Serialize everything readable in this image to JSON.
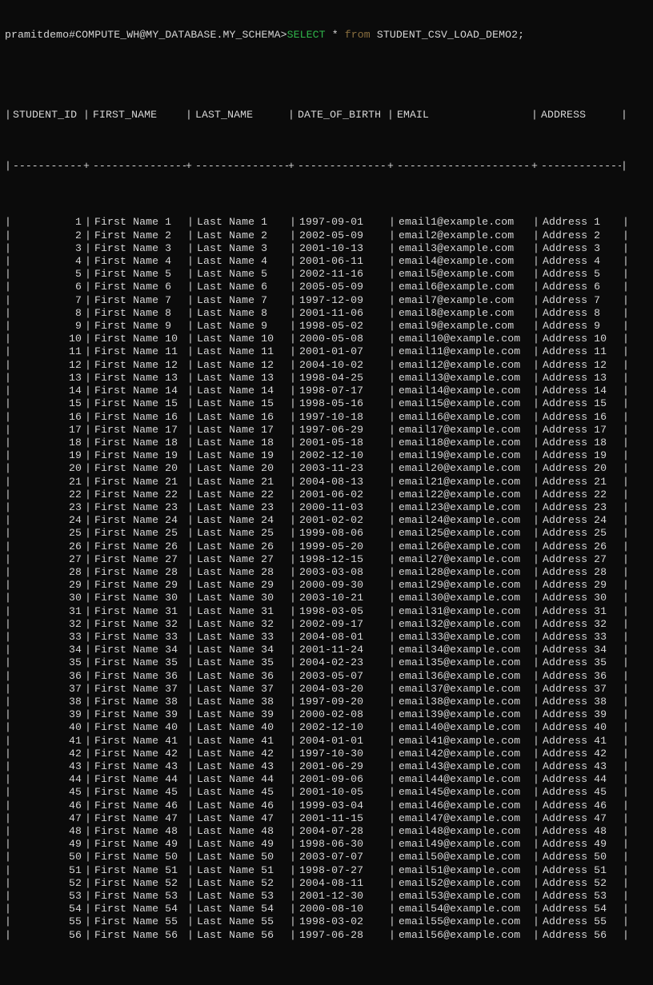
{
  "prompt": {
    "prefix": "pramitdemo#COMPUTE_WH@MY_DATABASE.MY_SCHEMA>",
    "select": "SELECT",
    "star": " * ",
    "from": "from",
    "rest": " STUDENT_CSV_LOAD_DEMO2;"
  },
  "columns": [
    "STUDENT_ID",
    "FIRST_NAME",
    "LAST_NAME",
    "DATE_OF_BIRTH",
    "EMAIL",
    "ADDRESS"
  ],
  "rows": [
    {
      "id": 1,
      "fn": "First Name 1",
      "ln": "Last Name 1",
      "dob": "1997-09-01",
      "em": "email1@example.com",
      "ad": "Address 1"
    },
    {
      "id": 2,
      "fn": "First Name 2",
      "ln": "Last Name 2",
      "dob": "2002-05-09",
      "em": "email2@example.com",
      "ad": "Address 2"
    },
    {
      "id": 3,
      "fn": "First Name 3",
      "ln": "Last Name 3",
      "dob": "2001-10-13",
      "em": "email3@example.com",
      "ad": "Address 3"
    },
    {
      "id": 4,
      "fn": "First Name 4",
      "ln": "Last Name 4",
      "dob": "2001-06-11",
      "em": "email4@example.com",
      "ad": "Address 4"
    },
    {
      "id": 5,
      "fn": "First Name 5",
      "ln": "Last Name 5",
      "dob": "2002-11-16",
      "em": "email5@example.com",
      "ad": "Address 5"
    },
    {
      "id": 6,
      "fn": "First Name 6",
      "ln": "Last Name 6",
      "dob": "2005-05-09",
      "em": "email6@example.com",
      "ad": "Address 6"
    },
    {
      "id": 7,
      "fn": "First Name 7",
      "ln": "Last Name 7",
      "dob": "1997-12-09",
      "em": "email7@example.com",
      "ad": "Address 7"
    },
    {
      "id": 8,
      "fn": "First Name 8",
      "ln": "Last Name 8",
      "dob": "2001-11-06",
      "em": "email8@example.com",
      "ad": "Address 8"
    },
    {
      "id": 9,
      "fn": "First Name 9",
      "ln": "Last Name 9",
      "dob": "1998-05-02",
      "em": "email9@example.com",
      "ad": "Address 9"
    },
    {
      "id": 10,
      "fn": "First Name 10",
      "ln": "Last Name 10",
      "dob": "2000-05-08",
      "em": "email10@example.com",
      "ad": "Address 10"
    },
    {
      "id": 11,
      "fn": "First Name 11",
      "ln": "Last Name 11",
      "dob": "2001-01-07",
      "em": "email11@example.com",
      "ad": "Address 11"
    },
    {
      "id": 12,
      "fn": "First Name 12",
      "ln": "Last Name 12",
      "dob": "2004-10-02",
      "em": "email12@example.com",
      "ad": "Address 12"
    },
    {
      "id": 13,
      "fn": "First Name 13",
      "ln": "Last Name 13",
      "dob": "1998-04-25",
      "em": "email13@example.com",
      "ad": "Address 13"
    },
    {
      "id": 14,
      "fn": "First Name 14",
      "ln": "Last Name 14",
      "dob": "1998-07-17",
      "em": "email14@example.com",
      "ad": "Address 14"
    },
    {
      "id": 15,
      "fn": "First Name 15",
      "ln": "Last Name 15",
      "dob": "1998-05-16",
      "em": "email15@example.com",
      "ad": "Address 15"
    },
    {
      "id": 16,
      "fn": "First Name 16",
      "ln": "Last Name 16",
      "dob": "1997-10-18",
      "em": "email16@example.com",
      "ad": "Address 16"
    },
    {
      "id": 17,
      "fn": "First Name 17",
      "ln": "Last Name 17",
      "dob": "1997-06-29",
      "em": "email17@example.com",
      "ad": "Address 17"
    },
    {
      "id": 18,
      "fn": "First Name 18",
      "ln": "Last Name 18",
      "dob": "2001-05-18",
      "em": "email18@example.com",
      "ad": "Address 18"
    },
    {
      "id": 19,
      "fn": "First Name 19",
      "ln": "Last Name 19",
      "dob": "2002-12-10",
      "em": "email19@example.com",
      "ad": "Address 19"
    },
    {
      "id": 20,
      "fn": "First Name 20",
      "ln": "Last Name 20",
      "dob": "2003-11-23",
      "em": "email20@example.com",
      "ad": "Address 20"
    },
    {
      "id": 21,
      "fn": "First Name 21",
      "ln": "Last Name 21",
      "dob": "2004-08-13",
      "em": "email21@example.com",
      "ad": "Address 21"
    },
    {
      "id": 22,
      "fn": "First Name 22",
      "ln": "Last Name 22",
      "dob": "2001-06-02",
      "em": "email22@example.com",
      "ad": "Address 22"
    },
    {
      "id": 23,
      "fn": "First Name 23",
      "ln": "Last Name 23",
      "dob": "2000-11-03",
      "em": "email23@example.com",
      "ad": "Address 23"
    },
    {
      "id": 24,
      "fn": "First Name 24",
      "ln": "Last Name 24",
      "dob": "2001-02-02",
      "em": "email24@example.com",
      "ad": "Address 24"
    },
    {
      "id": 25,
      "fn": "First Name 25",
      "ln": "Last Name 25",
      "dob": "1999-08-06",
      "em": "email25@example.com",
      "ad": "Address 25"
    },
    {
      "id": 26,
      "fn": "First Name 26",
      "ln": "Last Name 26",
      "dob": "1999-05-20",
      "em": "email26@example.com",
      "ad": "Address 26"
    },
    {
      "id": 27,
      "fn": "First Name 27",
      "ln": "Last Name 27",
      "dob": "1998-12-15",
      "em": "email27@example.com",
      "ad": "Address 27"
    },
    {
      "id": 28,
      "fn": "First Name 28",
      "ln": "Last Name 28",
      "dob": "2003-03-08",
      "em": "email28@example.com",
      "ad": "Address 28"
    },
    {
      "id": 29,
      "fn": "First Name 29",
      "ln": "Last Name 29",
      "dob": "2000-09-30",
      "em": "email29@example.com",
      "ad": "Address 29"
    },
    {
      "id": 30,
      "fn": "First Name 30",
      "ln": "Last Name 30",
      "dob": "2003-10-21",
      "em": "email30@example.com",
      "ad": "Address 30"
    },
    {
      "id": 31,
      "fn": "First Name 31",
      "ln": "Last Name 31",
      "dob": "1998-03-05",
      "em": "email31@example.com",
      "ad": "Address 31"
    },
    {
      "id": 32,
      "fn": "First Name 32",
      "ln": "Last Name 32",
      "dob": "2002-09-17",
      "em": "email32@example.com",
      "ad": "Address 32"
    },
    {
      "id": 33,
      "fn": "First Name 33",
      "ln": "Last Name 33",
      "dob": "2004-08-01",
      "em": "email33@example.com",
      "ad": "Address 33"
    },
    {
      "id": 34,
      "fn": "First Name 34",
      "ln": "Last Name 34",
      "dob": "2001-11-24",
      "em": "email34@example.com",
      "ad": "Address 34"
    },
    {
      "id": 35,
      "fn": "First Name 35",
      "ln": "Last Name 35",
      "dob": "2004-02-23",
      "em": "email35@example.com",
      "ad": "Address 35"
    },
    {
      "id": 36,
      "fn": "First Name 36",
      "ln": "Last Name 36",
      "dob": "2003-05-07",
      "em": "email36@example.com",
      "ad": "Address 36"
    },
    {
      "id": 37,
      "fn": "First Name 37",
      "ln": "Last Name 37",
      "dob": "2004-03-20",
      "em": "email37@example.com",
      "ad": "Address 37"
    },
    {
      "id": 38,
      "fn": "First Name 38",
      "ln": "Last Name 38",
      "dob": "1997-09-20",
      "em": "email38@example.com",
      "ad": "Address 38"
    },
    {
      "id": 39,
      "fn": "First Name 39",
      "ln": "Last Name 39",
      "dob": "2000-02-08",
      "em": "email39@example.com",
      "ad": "Address 39"
    },
    {
      "id": 40,
      "fn": "First Name 40",
      "ln": "Last Name 40",
      "dob": "2002-12-10",
      "em": "email40@example.com",
      "ad": "Address 40"
    },
    {
      "id": 41,
      "fn": "First Name 41",
      "ln": "Last Name 41",
      "dob": "2004-01-01",
      "em": "email41@example.com",
      "ad": "Address 41"
    },
    {
      "id": 42,
      "fn": "First Name 42",
      "ln": "Last Name 42",
      "dob": "1997-10-30",
      "em": "email42@example.com",
      "ad": "Address 42"
    },
    {
      "id": 43,
      "fn": "First Name 43",
      "ln": "Last Name 43",
      "dob": "2001-06-29",
      "em": "email43@example.com",
      "ad": "Address 43"
    },
    {
      "id": 44,
      "fn": "First Name 44",
      "ln": "Last Name 44",
      "dob": "2001-09-06",
      "em": "email44@example.com",
      "ad": "Address 44"
    },
    {
      "id": 45,
      "fn": "First Name 45",
      "ln": "Last Name 45",
      "dob": "2001-10-05",
      "em": "email45@example.com",
      "ad": "Address 45"
    },
    {
      "id": 46,
      "fn": "First Name 46",
      "ln": "Last Name 46",
      "dob": "1999-03-04",
      "em": "email46@example.com",
      "ad": "Address 46"
    },
    {
      "id": 47,
      "fn": "First Name 47",
      "ln": "Last Name 47",
      "dob": "2001-11-15",
      "em": "email47@example.com",
      "ad": "Address 47"
    },
    {
      "id": 48,
      "fn": "First Name 48",
      "ln": "Last Name 48",
      "dob": "2004-07-28",
      "em": "email48@example.com",
      "ad": "Address 48"
    },
    {
      "id": 49,
      "fn": "First Name 49",
      "ln": "Last Name 49",
      "dob": "1998-06-30",
      "em": "email49@example.com",
      "ad": "Address 49"
    },
    {
      "id": 50,
      "fn": "First Name 50",
      "ln": "Last Name 50",
      "dob": "2003-07-07",
      "em": "email50@example.com",
      "ad": "Address 50"
    },
    {
      "id": 51,
      "fn": "First Name 51",
      "ln": "Last Name 51",
      "dob": "1998-07-27",
      "em": "email51@example.com",
      "ad": "Address 51"
    },
    {
      "id": 52,
      "fn": "First Name 52",
      "ln": "Last Name 52",
      "dob": "2004-08-11",
      "em": "email52@example.com",
      "ad": "Address 52"
    },
    {
      "id": 53,
      "fn": "First Name 53",
      "ln": "Last Name 53",
      "dob": "2001-12-30",
      "em": "email53@example.com",
      "ad": "Address 53"
    },
    {
      "id": 54,
      "fn": "First Name 54",
      "ln": "Last Name 54",
      "dob": "2000-08-10",
      "em": "email54@example.com",
      "ad": "Address 54"
    },
    {
      "id": 55,
      "fn": "First Name 55",
      "ln": "Last Name 55",
      "dob": "1998-03-02",
      "em": "email55@example.com",
      "ad": "Address 55"
    },
    {
      "id": 56,
      "fn": "First Name 56",
      "ln": "Last Name 56",
      "dob": "1997-06-28",
      "em": "email56@example.com",
      "ad": "Address 56"
    }
  ]
}
